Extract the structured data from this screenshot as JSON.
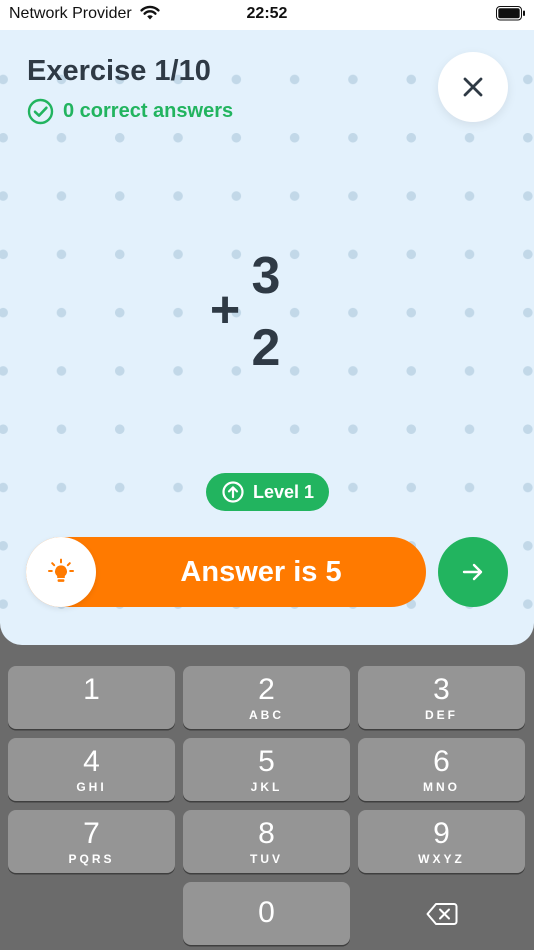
{
  "status_bar": {
    "carrier": "Network Provider",
    "time": "22:52",
    "wifi_icon": "wifi-icon",
    "battery_icon": "battery-icon"
  },
  "exercise": {
    "title": "Exercise 1/10",
    "correct_label": "0 correct answers",
    "correct_icon": "check-circle-icon",
    "close_icon": "close-icon"
  },
  "problem": {
    "operator": "+",
    "top_number": "3",
    "bottom_number": "2"
  },
  "level": {
    "label": "Level 1",
    "icon": "arrow-up-circle-icon"
  },
  "answer": {
    "text": "Answer is 5",
    "hint_icon": "lightbulb-icon",
    "next_icon": "arrow-right-icon"
  },
  "keypad": {
    "keys": [
      {
        "digit": "1",
        "letters": ""
      },
      {
        "digit": "2",
        "letters": "ABC"
      },
      {
        "digit": "3",
        "letters": "DEF"
      },
      {
        "digit": "4",
        "letters": "GHI"
      },
      {
        "digit": "5",
        "letters": "JKL"
      },
      {
        "digit": "6",
        "letters": "MNO"
      },
      {
        "digit": "7",
        "letters": "PQRS"
      },
      {
        "digit": "8",
        "letters": "TUV"
      },
      {
        "digit": "9",
        "letters": "WXYZ"
      },
      {
        "digit": "0",
        "letters": ""
      }
    ],
    "delete_icon": "backspace-icon"
  },
  "colors": {
    "accent_green": "#22b45f",
    "accent_orange": "#ff7a00",
    "card_background": "#e3f1fc",
    "text_dark": "#2f3a45"
  }
}
